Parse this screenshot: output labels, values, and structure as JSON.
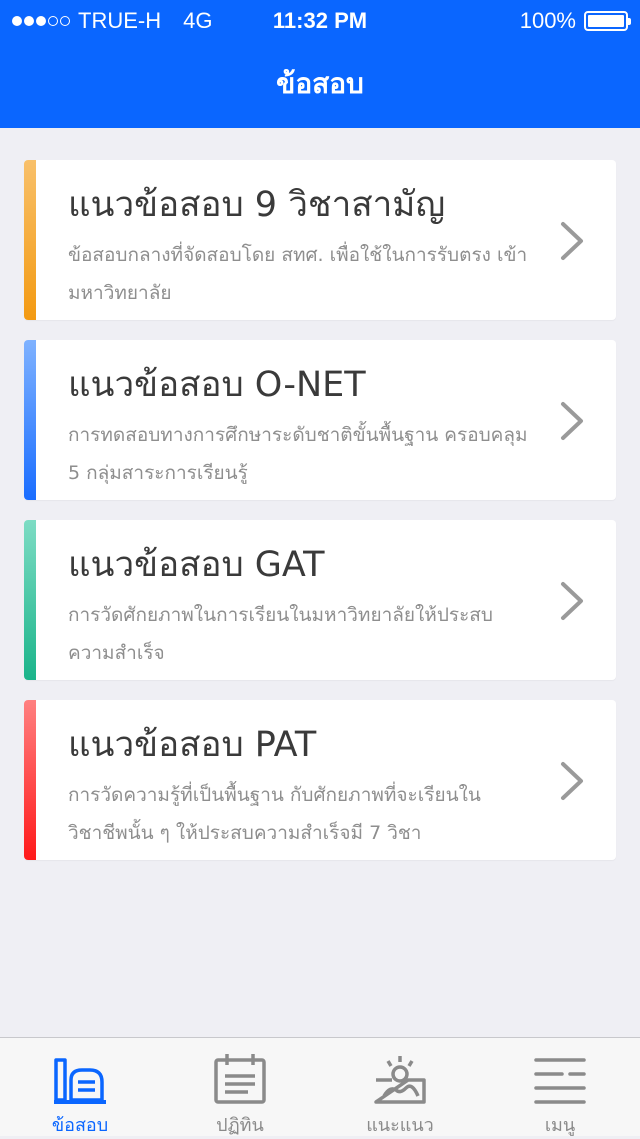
{
  "status_bar": {
    "carrier": "TRUE-H",
    "network": "4G",
    "time": "11:32 PM",
    "battery": "100%"
  },
  "nav": {
    "title": "ข้อสอบ"
  },
  "cards": [
    {
      "title": "แนวข้อสอบ 9 วิชาสามัญ",
      "description": "ข้อสอบกลางที่จัดสอบโดย สทศ. เพื่อใช้ในการรับตรง เข้ามหาวิทยาลัย",
      "accent": [
        "#f8c06a",
        "#f39a12"
      ]
    },
    {
      "title": "แนวข้อสอบ O-NET",
      "description": "การทดสอบทางการศึกษาระดับชาติขั้นพื้นฐาน ครอบคลุม 5 กลุ่มสาระการเรียนรู้",
      "accent": [
        "#7fb2ff",
        "#1a6dff"
      ]
    },
    {
      "title": "แนวข้อสอบ GAT",
      "description": "การวัดศักยภาพในการเรียนในมหาวิทยาลัยให้ประสบ ความสำเร็จ",
      "accent": [
        "#7ddcc4",
        "#1bb48a"
      ]
    },
    {
      "title": "แนวข้อสอบ PAT",
      "description": "การวัดความรู้ที่เป็นพื้นฐาน กับศักยภาพที่จะเรียนใน วิชาชีพนั้น ๆ ให้ประสบความสำเร็จมี 7 วิชา",
      "accent": [
        "#ff8080",
        "#ff1a1a"
      ]
    }
  ],
  "tabs": [
    {
      "label": "ข้อสอบ",
      "icon": "exam-icon",
      "active": true
    },
    {
      "label": "ปฏิทิน",
      "icon": "calendar-icon",
      "active": false
    },
    {
      "label": "แนะแนว",
      "icon": "guidance-icon",
      "active": false
    },
    {
      "label": "เมนู",
      "icon": "menu-icon",
      "active": false
    }
  ],
  "colors": {
    "primary": "#0a66ff",
    "background": "#efeff4",
    "tab_inactive": "#8a8a8a"
  }
}
